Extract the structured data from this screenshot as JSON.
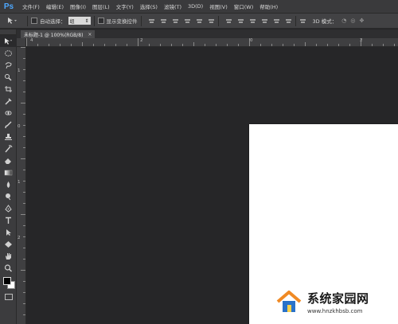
{
  "app": {
    "logo": "Ps"
  },
  "menu": [
    "文件(F)",
    "编辑(E)",
    "图像(I)",
    "图层(L)",
    "文字(Y)",
    "选择(S)",
    "滤镜(T)",
    "3D(D)",
    "视图(V)",
    "窗口(W)",
    "帮助(H)"
  ],
  "options": {
    "tool_icon": "move-tool-icon",
    "auto_select_label": "自动选择：",
    "auto_select_value": "组",
    "show_transform_label": "显示变换控件",
    "mode_3d_label": "3D 模式："
  },
  "document_tab": {
    "title": "未标题-1 @ 100%(RGB/8)",
    "close": "×"
  },
  "ruler": {
    "top_labels": [
      "4",
      "2",
      "0",
      "2"
    ],
    "left_labels": [
      "1",
      "0",
      "1",
      "2"
    ]
  },
  "tools": [
    "move-tool-icon",
    "marquee-tool-icon",
    "lasso-tool-icon",
    "quick-select-tool-icon",
    "crop-tool-icon",
    "eyedropper-tool-icon",
    "healing-brush-tool-icon",
    "brush-tool-icon",
    "clone-stamp-tool-icon",
    "history-brush-tool-icon",
    "eraser-tool-icon",
    "gradient-tool-icon",
    "blur-tool-icon",
    "dodge-tool-icon",
    "pen-tool-icon",
    "type-tool-icon",
    "path-select-tool-icon",
    "shape-tool-icon",
    "hand-tool-icon",
    "zoom-tool-icon"
  ],
  "colors": {
    "foreground": "#000000",
    "background": "#ffffff",
    "accent": "#4ea8ff"
  },
  "watermark": {
    "title": "系统家园网",
    "url": "www.hnzkhbsb.com"
  }
}
